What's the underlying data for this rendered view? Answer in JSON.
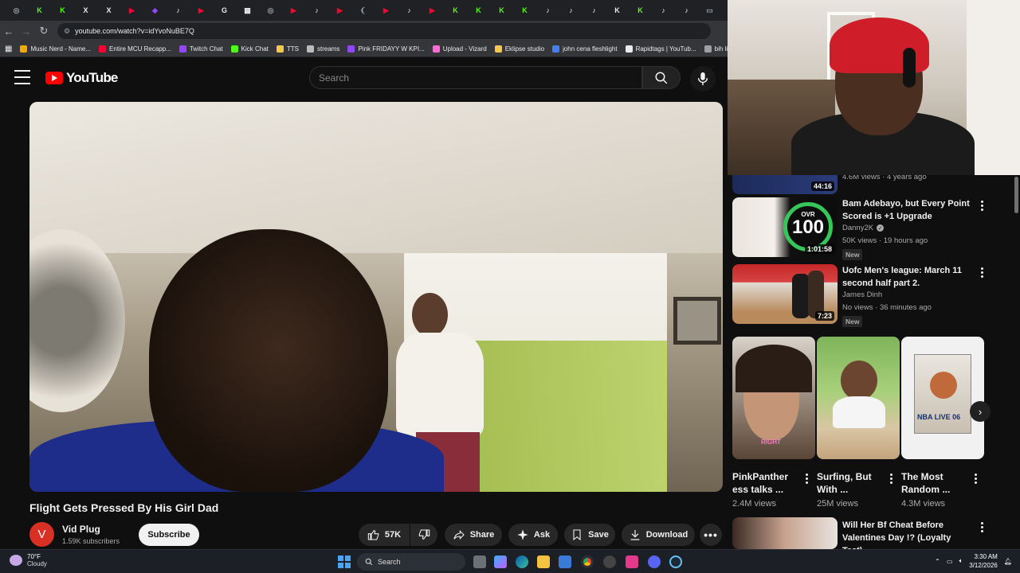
{
  "browser": {
    "url": "youtube.com/watch?v=idYvoNuBE7Q",
    "tab_icons": [
      {
        "glyph": "◎",
        "color": "#9aa0a6"
      },
      {
        "glyph": "K",
        "color": "#53fc18"
      },
      {
        "glyph": "K",
        "color": "#53fc18"
      },
      {
        "glyph": "X",
        "color": "#e8eaed"
      },
      {
        "glyph": "X",
        "color": "#e8eaed"
      },
      {
        "glyph": "▶",
        "color": "#ff0033"
      },
      {
        "glyph": "◆",
        "color": "#9146ff"
      },
      {
        "glyph": "♪",
        "color": "#e8eaed"
      },
      {
        "glyph": "▶",
        "color": "#ff0033"
      },
      {
        "glyph": "G",
        "color": "#e8eaed"
      },
      {
        "glyph": "▦",
        "color": "#e8eaed"
      },
      {
        "glyph": "◎",
        "color": "#9aa0a6"
      },
      {
        "glyph": "▶",
        "color": "#ff0033"
      },
      {
        "glyph": "♪",
        "color": "#e8eaed"
      },
      {
        "glyph": "▶",
        "color": "#ff0033"
      },
      {
        "glyph": "❨",
        "color": "#9aa0a6"
      },
      {
        "glyph": "▶",
        "color": "#ff0033"
      },
      {
        "glyph": "♪",
        "color": "#e8eaed"
      },
      {
        "glyph": "▶",
        "color": "#ff0033"
      },
      {
        "glyph": "K",
        "color": "#53fc18"
      },
      {
        "glyph": "K",
        "color": "#53fc18"
      },
      {
        "glyph": "K",
        "color": "#53fc18"
      },
      {
        "glyph": "K",
        "color": "#53fc18"
      },
      {
        "glyph": "♪",
        "color": "#e8eaed"
      },
      {
        "glyph": "♪",
        "color": "#e8eaed"
      },
      {
        "glyph": "♪",
        "color": "#e8eaed"
      },
      {
        "glyph": "K",
        "color": "#e8eaed"
      },
      {
        "glyph": "K",
        "color": "#53fc18"
      },
      {
        "glyph": "♪",
        "color": "#e8eaed"
      },
      {
        "glyph": "♪",
        "color": "#e8eaed"
      },
      {
        "glyph": "▭",
        "color": "#9aa0a6"
      }
    ],
    "bookmarks": [
      {
        "label": "Music Nerd - Name...",
        "color": "#f2a900"
      },
      {
        "label": "Entire MCU Recapp...",
        "color": "#ff0033"
      },
      {
        "label": "Twitch Chat",
        "color": "#9146ff"
      },
      {
        "label": "Kick Chat",
        "color": "#53fc18"
      },
      {
        "label": "TTS",
        "color": "#f2c94c"
      },
      {
        "label": "streams",
        "color": "#bbbbbb"
      },
      {
        "label": "Pink FRIDAYY W KPI...",
        "color": "#9146ff"
      },
      {
        "label": "Upload - Vizard",
        "color": "#ff6bd5"
      },
      {
        "label": "Eklipse studio",
        "color": "#f2c94c"
      },
      {
        "label": "john cena fleshlight",
        "color": "#4a7cf5"
      },
      {
        "label": "Rapidtags | YouTub...",
        "color": "#e8eaed"
      },
      {
        "label": "bih links",
        "color": "#9aa0a6"
      }
    ]
  },
  "youtube": {
    "logo_text": "YouTube",
    "search_placeholder": "Search"
  },
  "video": {
    "title": "Flight Gets Pressed By His Girl Dad",
    "channel_initial": "V",
    "channel": "Vid Plug",
    "subscribers": "1.59K subscribers",
    "subscribe_label": "Subscribe",
    "likes": "57K",
    "share_label": "Share",
    "ask_label": "Ask",
    "save_label": "Save",
    "download_label": "Download"
  },
  "sidebar": {
    "top_meta": "4.6M views · 4 years ago",
    "top_duration": "44:16",
    "recs": [
      {
        "title": "Bam Adebayo, but Every Point Scored is +1 Upgrade",
        "channel": "Danny2K",
        "meta": "50K views · 19 hours ago",
        "badge": "New",
        "duration": "1:01:58",
        "overlay": "100",
        "overlay_label": "OVR"
      },
      {
        "title": "Uofc Men's league: March 11 second half part 2.",
        "channel": "James Dinh",
        "meta": "No views · 36 minutes ago",
        "badge": "New",
        "duration": "7:23"
      }
    ],
    "shorts": [
      {
        "title": "PinkPanther ess talks ...",
        "views": "2.4M views",
        "caption": "RIGHT"
      },
      {
        "title": "Surfing, But With ...",
        "views": "25M views"
      },
      {
        "title": "The Most Random ...",
        "views": "4.3M views",
        "caption": "NBA LIVE 06"
      }
    ],
    "bottom_rec": {
      "title": "Will Her Bf Cheat Before Valentines Day !? (Loyalty Test)"
    }
  },
  "taskbar": {
    "weather_temp": "70°F",
    "weather_desc": "Cloudy",
    "search_label": "Search",
    "time": "3:30 AM",
    "date": "3/12/2026"
  }
}
